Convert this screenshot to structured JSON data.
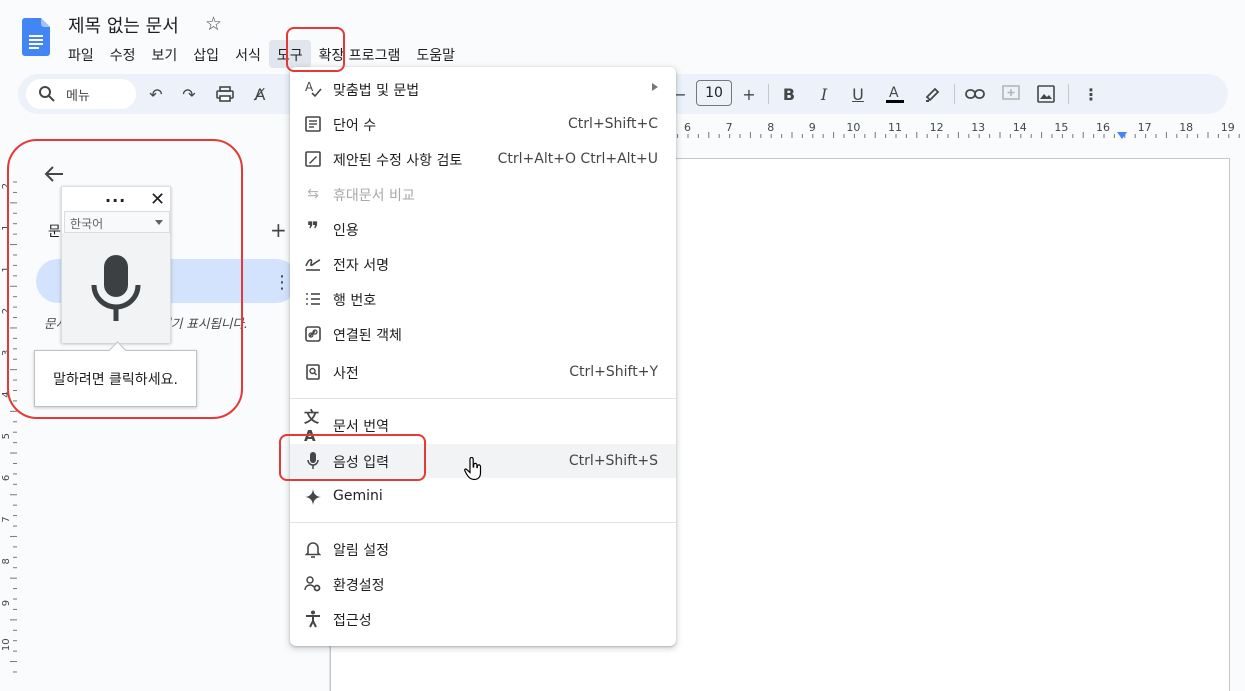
{
  "document": {
    "title": "제목 없는 문서"
  },
  "menubar": {
    "items": [
      "파일",
      "수정",
      "보기",
      "삽입",
      "서식",
      "도구",
      "확장 프로그램",
      "도움말"
    ],
    "active": "도구"
  },
  "toolbar": {
    "search_label": "메뉴",
    "font_size": "10"
  },
  "ruler": {
    "horizontal_ticks": [
      "6",
      "7",
      "8",
      "9",
      "10",
      "11",
      "12",
      "13",
      "14",
      "15",
      "16",
      "17",
      "18",
      "19"
    ],
    "vertical_ticks": [
      "2",
      "1",
      "1",
      "2",
      "3",
      "4",
      "5",
      "6",
      "7",
      "8",
      "9",
      "10"
    ]
  },
  "sidebar": {
    "outline_label": "문",
    "outline_hint": "문서에 추가한 제목이 여기 표시됩니다."
  },
  "voice_widget": {
    "language": "한국어",
    "tooltip": "말하려면 클릭하세요."
  },
  "tools_menu": {
    "items": [
      {
        "label": "맞춤법 및 문법",
        "shortcut": "",
        "icon": "spellcheck-icon",
        "submenu": true
      },
      {
        "label": "단어 수",
        "shortcut": "Ctrl+Shift+C",
        "icon": "word-count-icon"
      },
      {
        "label": "제안된 수정 사항 검토",
        "shortcut": "Ctrl+Alt+O Ctrl+Alt+U",
        "icon": "review-edits-icon"
      },
      {
        "label": "휴대문서 비교",
        "shortcut": "",
        "icon": "compare-icon",
        "disabled": true
      },
      {
        "label": "인용",
        "shortcut": "",
        "icon": "quote-icon"
      },
      {
        "label": "전자 서명",
        "shortcut": "",
        "icon": "signature-icon"
      },
      {
        "label": "행 번호",
        "shortcut": "",
        "icon": "line-numbers-icon"
      },
      {
        "label": "연결된 객체",
        "shortcut": "",
        "icon": "linked-objects-icon"
      },
      {
        "label": "사전",
        "shortcut": "Ctrl+Shift+Y",
        "icon": "dictionary-icon"
      },
      {
        "label": "문서 번역",
        "shortcut": "",
        "icon": "translate-icon"
      },
      {
        "label": "음성 입력",
        "shortcut": "Ctrl+Shift+S",
        "icon": "mic-icon",
        "hover": true
      },
      {
        "label": "Gemini",
        "shortcut": "",
        "icon": "gemini-icon"
      },
      {
        "label": "알림 설정",
        "shortcut": "",
        "icon": "bell-icon"
      },
      {
        "label": "환경설정",
        "shortcut": "",
        "icon": "preferences-icon"
      },
      {
        "label": "접근성",
        "shortcut": "",
        "icon": "accessibility-icon"
      }
    ]
  },
  "colors": {
    "accent_blue": "#4285f4",
    "highlight_red": "#e53935",
    "hover_gray": "#f1f3f4"
  }
}
